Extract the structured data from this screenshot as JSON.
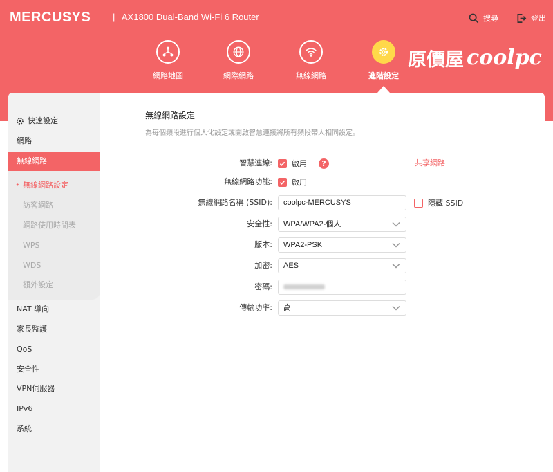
{
  "header": {
    "brand": "MERCUSYS",
    "separator": "|",
    "model": "AX1800 Dual-Band Wi-Fi 6 Router",
    "search_label": "搜尋",
    "logout_label": "登出",
    "accent_color": "#f36466",
    "active_color": "#ffd84a"
  },
  "nav": [
    {
      "label": "網路地圖",
      "icon": "network-map-icon"
    },
    {
      "label": "網際網路",
      "icon": "globe-icon"
    },
    {
      "label": "無線網路",
      "icon": "wifi-icon"
    },
    {
      "label": "進階設定",
      "icon": "gear-icon",
      "active": true
    }
  ],
  "watermark": {
    "cjk": "原價屋",
    "latin": "coolpc"
  },
  "sidebar": {
    "items": [
      {
        "label": "快速設定",
        "icon": "gear-icon"
      },
      {
        "label": "網路"
      },
      {
        "label": "無線網路",
        "active": true
      },
      {
        "label": "NAT 導向"
      },
      {
        "label": "家長監護"
      },
      {
        "label": "QoS"
      },
      {
        "label": "安全性"
      },
      {
        "label": "VPN伺服器"
      },
      {
        "label": "IPv6"
      },
      {
        "label": "系統"
      }
    ],
    "sub_items": [
      {
        "label": "無線網路設定",
        "active": true
      },
      {
        "label": "訪客網路"
      },
      {
        "label": "網路使用時間表"
      },
      {
        "label": "WPS"
      },
      {
        "label": "WDS"
      },
      {
        "label": "額外設定"
      }
    ]
  },
  "main": {
    "title": "無線網路設定",
    "description": "為每個頻段進行個人化設定或開啟智慧連接將所有頻段帶人相同設定。",
    "smart_connect": {
      "label": "智慧連線:",
      "checkbox_label": "啟用",
      "checked": true,
      "help": "?"
    },
    "share_network": "共享網路",
    "wireless_function": {
      "label": "無線網路功能:",
      "checkbox_label": "啟用",
      "checked": true
    },
    "ssid": {
      "label": "無線網路名稱 (SSID):",
      "value": "coolpc-MERCUSYS"
    },
    "hide_ssid": {
      "label": "隱藏 SSID",
      "checked": false
    },
    "security": {
      "label": "安全性:",
      "value": "WPA/WPA2-個人"
    },
    "version": {
      "label": "版本:",
      "value": "WPA2-PSK"
    },
    "encryption": {
      "label": "加密:",
      "value": "AES"
    },
    "password": {
      "label": "密碼:"
    },
    "tx_power": {
      "label": "傳輸功率:",
      "value": "高"
    }
  }
}
